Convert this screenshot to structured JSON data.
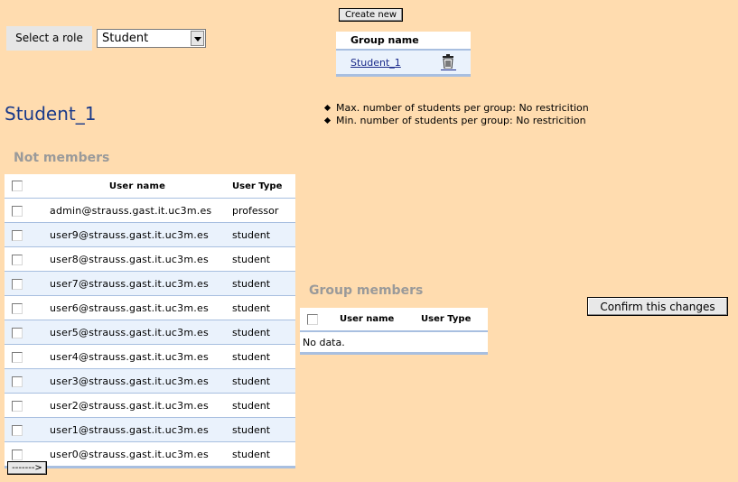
{
  "role_selector": {
    "label": "Select a role",
    "selected": "Student"
  },
  "groups": {
    "create_new_label": "Create new",
    "column_header": "Group name",
    "items": [
      {
        "name": "Student_1"
      }
    ]
  },
  "selected_group": {
    "title": "Student_1",
    "restrictions": [
      "Max. number of students per group: No restricition",
      "Min. number of students per group: No restricition"
    ]
  },
  "not_members": {
    "heading": "Not members",
    "columns": [
      "User name",
      "User Type"
    ],
    "rows": [
      {
        "user": "admin@strauss.gast.it.uc3m.es",
        "type": "professor"
      },
      {
        "user": "user9@strauss.gast.it.uc3m.es",
        "type": "student"
      },
      {
        "user": "user8@strauss.gast.it.uc3m.es",
        "type": "student"
      },
      {
        "user": "user7@strauss.gast.it.uc3m.es",
        "type": "student"
      },
      {
        "user": "user6@strauss.gast.it.uc3m.es",
        "type": "student"
      },
      {
        "user": "user5@strauss.gast.it.uc3m.es",
        "type": "student"
      },
      {
        "user": "user4@strauss.gast.it.uc3m.es",
        "type": "student"
      },
      {
        "user": "user3@strauss.gast.it.uc3m.es",
        "type": "student"
      },
      {
        "user": "user2@strauss.gast.it.uc3m.es",
        "type": "student"
      },
      {
        "user": "user1@strauss.gast.it.uc3m.es",
        "type": "student"
      },
      {
        "user": "user0@strauss.gast.it.uc3m.es",
        "type": "student"
      }
    ],
    "move_button_label": "------->"
  },
  "group_members": {
    "heading": "Group members",
    "columns": [
      "User name",
      "User Type"
    ],
    "empty_text": "No data."
  },
  "confirm_button_label": "Confirm this changes",
  "icons": {
    "delete": "trash-icon",
    "dropdown": "chevron-down-icon"
  },
  "colors": {
    "background": "#ffdcaf",
    "title": "#1a3a8a",
    "row_alt": "#eaf2fc",
    "row_border": "#a8bfe0"
  }
}
